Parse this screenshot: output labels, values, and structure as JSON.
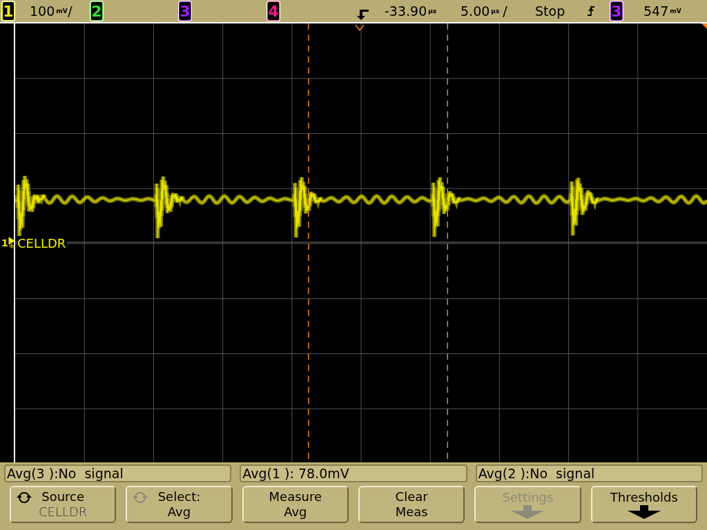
{
  "status_bar": {
    "channels": [
      {
        "number": "1",
        "color": "#f0f000",
        "scale": {
          "value": "100",
          "unit": "mV",
          "suffix": "/"
        }
      },
      {
        "number": "2",
        "color": "#30e030"
      },
      {
        "number": "3",
        "color": "#a020f0"
      },
      {
        "number": "4",
        "color": "#f01890"
      }
    ],
    "delay": {
      "value": "-33.90",
      "unit": "µs"
    },
    "timebase": {
      "value": "5.00",
      "unit": "µs",
      "suffix": "/"
    },
    "run_state": "Stop",
    "trigger": {
      "source": "3",
      "color": "#a020f0",
      "level": {
        "value": "547",
        "unit": "mV"
      }
    }
  },
  "display": {
    "ground_marker": {
      "channel": "1",
      "label": "CELLDR"
    }
  },
  "measurements": [
    "Avg(3 ):No  signal",
    "Avg(1 ): 78.0mV",
    "Avg(2 ):No  signal"
  ],
  "softkeys": [
    {
      "kind": "knob",
      "label": "Source",
      "value": "CELLDR",
      "disabled": false
    },
    {
      "kind": "knob-dim",
      "label": "Select:",
      "value": "Avg",
      "disabled": false
    },
    {
      "kind": "plain",
      "label": "Measure",
      "value": "Avg",
      "disabled": false
    },
    {
      "kind": "plain",
      "label": "Clear",
      "value": "Meas",
      "disabled": false
    },
    {
      "kind": "arrow",
      "label": "Settings",
      "disabled": true
    },
    {
      "kind": "arrow",
      "label": "Thresholds",
      "disabled": false
    }
  ]
}
